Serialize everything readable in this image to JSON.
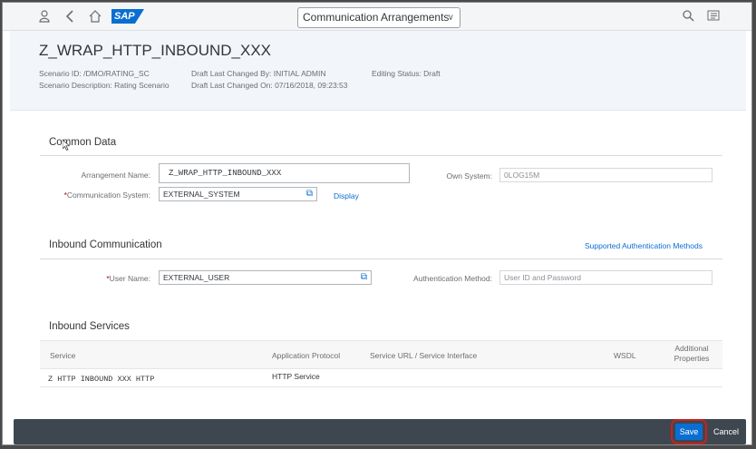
{
  "shell": {
    "app_title": "Communication Arrangements",
    "logo_text": "SAP",
    "icons": [
      "user-icon",
      "back-icon",
      "home-icon",
      "search-icon",
      "notifications-icon"
    ]
  },
  "header": {
    "title": "Z_WRAP_HTTP_INBOUND_XXX",
    "scenario_id": "Scenario ID: /DMO/RATING_SC",
    "scenario_description": "Scenario Description: Rating Scenario",
    "draft_changed_by": "Draft Last Changed By: INITIAL ADMIN",
    "draft_changed_on": "Draft Last Changed On: 07/16/2018, 09:23:53",
    "editing_status": "Editing Status: Draft"
  },
  "common_data": {
    "title": "Common Data",
    "arrangement_name_label": "Arrangement Name:",
    "arrangement_name_value": "Z_WRAP_HTTP_INBOUND_XXX",
    "own_system_label": "Own System:",
    "own_system_value": "0LOG15M",
    "comm_system_label": "Communication System:",
    "comm_system_value": "EXTERNAL_SYSTEM",
    "display_link": "Display"
  },
  "inbound_communication": {
    "title": "Inbound Communication",
    "auth_methods_link": "Supported Authentication Methods",
    "user_name_label": "User Name:",
    "user_name_value": "EXTERNAL_USER",
    "auth_method_label": "Authentication Method:",
    "auth_method_placeholder": "User ID and Password"
  },
  "inbound_services": {
    "title": "Inbound Services",
    "columns": [
      "Service",
      "Application Protocol",
      "Service URL / Service Interface",
      "WSDL",
      "Additional Properties"
    ],
    "rows": [
      {
        "service": "Z HTTP INBOUND XXX HTTP",
        "protocol": "HTTP Service",
        "url": "",
        "wsdl": "",
        "props": ""
      }
    ]
  },
  "footer": {
    "save_label": "Save",
    "cancel_label": "Cancel"
  },
  "colors": {
    "accent": "#0a6ed1",
    "footer_bg": "#3e4750",
    "required": "#bb0000",
    "highlight": "#c9211e"
  }
}
